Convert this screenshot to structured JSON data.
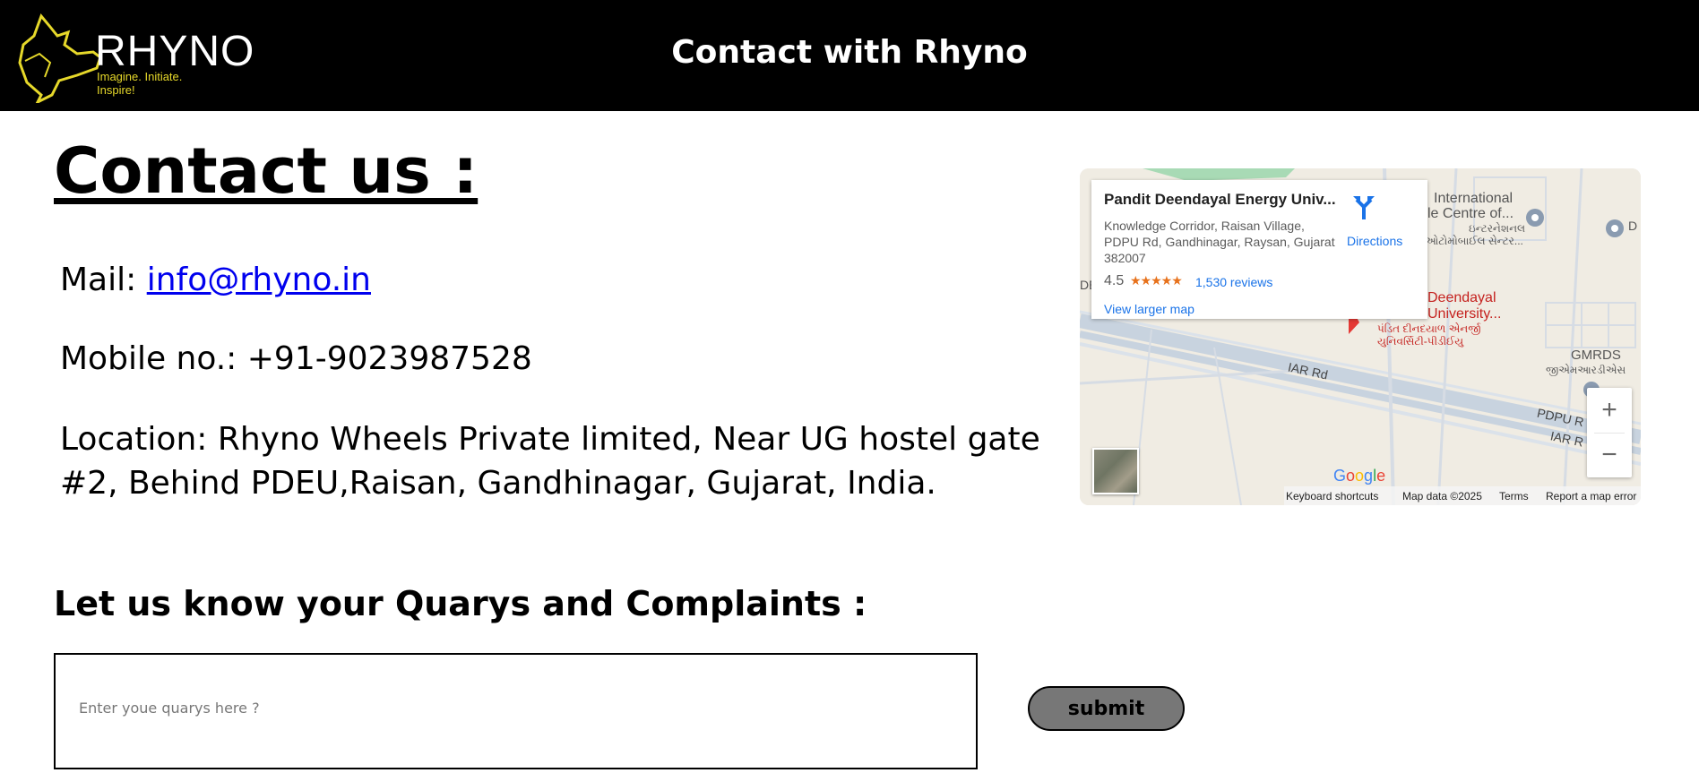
{
  "header": {
    "logo_word": "RHYNO",
    "logo_tagline": "Imagine. Initiate. Inspire!",
    "title": "Contact with Rhyno",
    "accent_color": "#e6d82a"
  },
  "contact": {
    "heading": "Contact us :",
    "mail_label": "Mail:",
    "mail_value": "info@rhyno.in",
    "mobile": "Mobile no.: +91-9023987528",
    "location": "Location: Rhyno Wheels Private limited, Near UG hostel gate #2, Behind PDEU,Raisan, Gandhinagar, Gujarat, India."
  },
  "map": {
    "place_name": "Pandit Deendayal Energy Univ...",
    "address": "Knowledge Corridor, Raisan Village, PDPU Rd, Gandhinagar, Raysan, Gujarat 382007",
    "rating": "4.5",
    "stars": "★★★★★",
    "reviews": "1,530 reviews",
    "directions": "Directions",
    "view_larger": "View larger map",
    "zoom_in": "+",
    "zoom_out": "−",
    "labels": {
      "intl_centre": "International",
      "intl_centre_2": "le Centre of...",
      "intl_gu": "ઇન્ટરનેશનલ",
      "intl_gu_2": "ઓટોમોબાઈલ સેન્ટર...",
      "deendayal_1": "Deendayal",
      "deendayal_2": "University...",
      "deendayal_gu_1": "પંડિત દીનદયાળ એનર્જી",
      "deendayal_gu_2": "યુનિવર્સિટી-પીડીઈયુ",
      "gmrds": "GMRDS",
      "gmrds_gu": "જીએમઆરડીએસ",
      "iar_rd": "IAR Rd",
      "pdpu_r": "PDPU R",
      "iar_r": "IAR R",
      "edge_de": "DE",
      "edge_d": "D"
    },
    "google": "Google",
    "footer": {
      "shortcuts": "Keyboard shortcuts",
      "data": "Map data ©2025",
      "terms": "Terms",
      "report": "Report a map error"
    }
  },
  "form": {
    "heading": "Let us know your Quarys and Complaints :",
    "placeholder": "Enter youe quarys here ?",
    "submit": "submit"
  }
}
